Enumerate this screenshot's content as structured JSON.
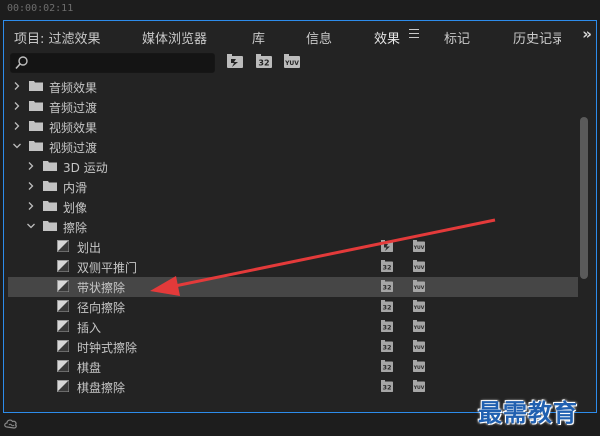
{
  "timecode": "00:00:02:11",
  "tabs": [
    {
      "label": "项目: 过滤效果",
      "active": false
    },
    {
      "label": "媒体浏览器",
      "active": false
    },
    {
      "label": "库",
      "active": false
    },
    {
      "label": "信息",
      "active": false
    },
    {
      "label": "效果",
      "active": true
    },
    {
      "label": "标记",
      "active": false
    },
    {
      "label": "历史记录",
      "active": false
    }
  ],
  "more_glyph": "»",
  "search": {
    "value": "",
    "placeholder": ""
  },
  "filters": [
    {
      "icon": "accelerated-effects-icon"
    },
    {
      "icon": "32-bit-color-icon",
      "text": "32"
    },
    {
      "icon": "yuv-effects-icon",
      "text": "YUV"
    }
  ],
  "tree": [
    {
      "label": "音频效果",
      "level": 0,
      "type": "folder",
      "expanded": false
    },
    {
      "label": "音频过渡",
      "level": 0,
      "type": "folder",
      "expanded": false
    },
    {
      "label": "视频效果",
      "level": 0,
      "type": "folder",
      "expanded": false
    },
    {
      "label": "视频过渡",
      "level": 0,
      "type": "folder",
      "expanded": true
    },
    {
      "label": "3D 运动",
      "level": 1,
      "type": "folder",
      "expanded": false
    },
    {
      "label": "内滑",
      "level": 1,
      "type": "folder",
      "expanded": false
    },
    {
      "label": "划像",
      "level": 1,
      "type": "folder",
      "expanded": false
    },
    {
      "label": "擦除",
      "level": 1,
      "type": "folder",
      "expanded": true
    },
    {
      "label": "划出",
      "level": 2,
      "type": "effect",
      "badges": [
        "accel",
        "yuv"
      ]
    },
    {
      "label": "双侧平推门",
      "level": 2,
      "type": "effect",
      "badges": [
        "32",
        "yuv"
      ]
    },
    {
      "label": "带状擦除",
      "level": 2,
      "type": "effect",
      "badges": [
        "32",
        "yuv"
      ],
      "selected": true
    },
    {
      "label": "径向擦除",
      "level": 2,
      "type": "effect",
      "badges": [
        "32",
        "yuv"
      ]
    },
    {
      "label": "插入",
      "level": 2,
      "type": "effect",
      "badges": [
        "32",
        "yuv"
      ]
    },
    {
      "label": "时钟式擦除",
      "level": 2,
      "type": "effect",
      "badges": [
        "32",
        "yuv"
      ]
    },
    {
      "label": "棋盘",
      "level": 2,
      "type": "effect",
      "badges": [
        "32",
        "yuv"
      ]
    },
    {
      "label": "棋盘擦除",
      "level": 2,
      "type": "effect",
      "badges": [
        "32",
        "yuv"
      ]
    }
  ],
  "scroll_position": 0.0,
  "watermark": "最需教育",
  "colors": {
    "panel_focus_border": "#2d8ceb",
    "selection": "#464646",
    "annotation_arrow": "#e33a3a",
    "watermark": "#2060b0"
  }
}
